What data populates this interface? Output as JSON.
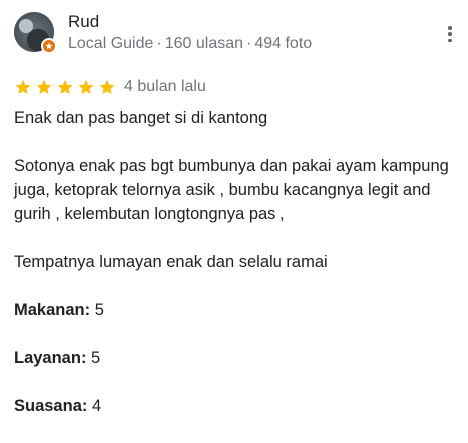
{
  "reviewer": {
    "name": "Rud",
    "level": "Local Guide",
    "reviews": "160 ulasan",
    "photos": "494 foto",
    "separator": "·"
  },
  "rating": {
    "stars": 5,
    "max_stars": 5,
    "when": "4 bulan lalu",
    "star_color": "#fbbc04"
  },
  "body": {
    "line1": "Enak dan pas banget si di kantong",
    "paragraph2": "Sotonya enak pas bgt bumbunya dan pakai ayam kampung juga, ketoprak telornya asik , bumbu kacangnya legit and gurih , kelembutan longtongnya pas ,",
    "paragraph3": "Tempatnya lumayan enak dan selalu ramai"
  },
  "attributes": [
    {
      "label": "Makanan:",
      "value": "5"
    },
    {
      "label": "Layanan:",
      "value": "5"
    },
    {
      "label": "Suasana:",
      "value": "4"
    }
  ],
  "colors": {
    "badge": "#e8710a",
    "secondary_text": "#70757a"
  },
  "icons": {
    "menu": "more-vert-icon",
    "badge": "local-guide-badge-icon",
    "star": "star-icon"
  }
}
